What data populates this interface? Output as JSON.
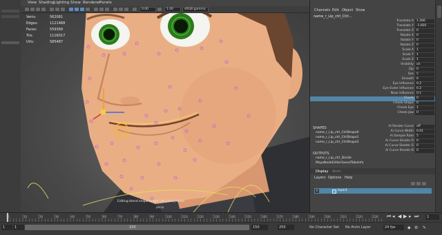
{
  "viewport": {
    "menu": [
      "View",
      "Shading",
      "Lighting",
      "Show",
      "Renderer",
      "Panels"
    ],
    "toolbar": {
      "value1": "0.00",
      "value2": "1.00",
      "colorspace": "sRGB gamma"
    },
    "hud": [
      {
        "label": "Verts:",
        "value": "562081"
      },
      {
        "label": "Edges:",
        "value": "1121468"
      },
      {
        "label": "Faces:",
        "value": "559369"
      },
      {
        "label": "Tris:",
        "value": "1116017"
      },
      {
        "label": "UVs:",
        "value": "585487"
      }
    ],
    "caption": "Editing blend shape target: ctr_Lock_Ranks",
    "caption2": "persp"
  },
  "channel_box": {
    "menu": [
      "Channels",
      "Edit",
      "Object",
      "Show"
    ],
    "node": "name_r_Lip_ctrl_Ctrl...",
    "attributes": [
      {
        "label": "Translate X",
        "value": "1.266"
      },
      {
        "label": "Translate Y",
        "value": "-1.605"
      },
      {
        "label": "Translate Z",
        "value": "0"
      },
      {
        "label": "Rotate X",
        "value": "0"
      },
      {
        "label": "Rotate Y",
        "value": "0"
      },
      {
        "label": "Rotate Z",
        "value": "0"
      },
      {
        "label": "Scale X",
        "value": "1"
      },
      {
        "label": "Scale Y",
        "value": "1"
      },
      {
        "label": "Scale Z",
        "value": "1"
      },
      {
        "label": "Visibility",
        "value": "on"
      },
      {
        "label": "Zip",
        "value": "0"
      },
      {
        "label": "Sex",
        "value": "5"
      },
      {
        "label": "Smooth",
        "value": "0"
      },
      {
        "label": "Eye Influence",
        "value": "0.2"
      },
      {
        "label": "Eye Outer Influence",
        "value": "0.2"
      },
      {
        "label": "Nose Influence",
        "value": "0.1"
      },
      {
        "label": "Cheek",
        "value": "0"
      },
      {
        "label": "Cheek Shape",
        "value": "0"
      },
      {
        "label": "Cheek Eye",
        "value": "1"
      },
      {
        "label": "Cheek Jaw",
        "value": "0"
      }
    ],
    "shapes_header": "SHAPES",
    "shapes": [
      "name_r_Lip_ctrl_CtrlShape0",
      "name_r_Lip_ctrl_CtrlShape1",
      "name_r_Lip_ctrl_CtrlShape2"
    ],
    "shape_attrs": [
      {
        "label": "Ai Render Curve",
        "value": "off"
      },
      {
        "label": "Ai Curve Width",
        "value": "0.01"
      },
      {
        "label": "Ai Sample Rate",
        "value": "5"
      },
      {
        "label": "Ai Curve Shader R",
        "value": "0"
      },
      {
        "label": "Ai Curve Shader G",
        "value": "0"
      },
      {
        "label": "Ai Curve Shader B",
        "value": "0"
      }
    ],
    "outputs_header": "OUTPUTS",
    "outputs": [
      "name_r_Lip_ctrl_Divide",
      "MayaNodeEditorSavedTabsInfo"
    ]
  },
  "layer_editor": {
    "tabs": [
      "Display",
      "Anim"
    ],
    "menu": [
      "Layers",
      "Options",
      "Help"
    ],
    "layer_visibility": "V",
    "layer_name": "layer1"
  },
  "timeline": {
    "ticks": [
      "0",
      "10",
      "20",
      "30",
      "40",
      "50",
      "60",
      "70",
      "80",
      "90",
      "100",
      "110",
      "120",
      "130",
      "140",
      "150",
      "160",
      "170",
      "180",
      "190",
      "200",
      "210",
      "220",
      "230"
    ],
    "current_frame": "1"
  },
  "range": {
    "start": "1",
    "start_inner": "1",
    "end_inner": "150",
    "end": "150",
    "anim_end": "250",
    "character_set": "No Character Set",
    "anim_layer": "No Anim Layer",
    "fps": "24 fps"
  },
  "colors": {
    "accent": "#5285a6",
    "panel": "#444444",
    "skin": "#e9ad83",
    "hair": "#6a4530",
    "iris": "#2d7a1a",
    "controls": "#c86bc8"
  }
}
